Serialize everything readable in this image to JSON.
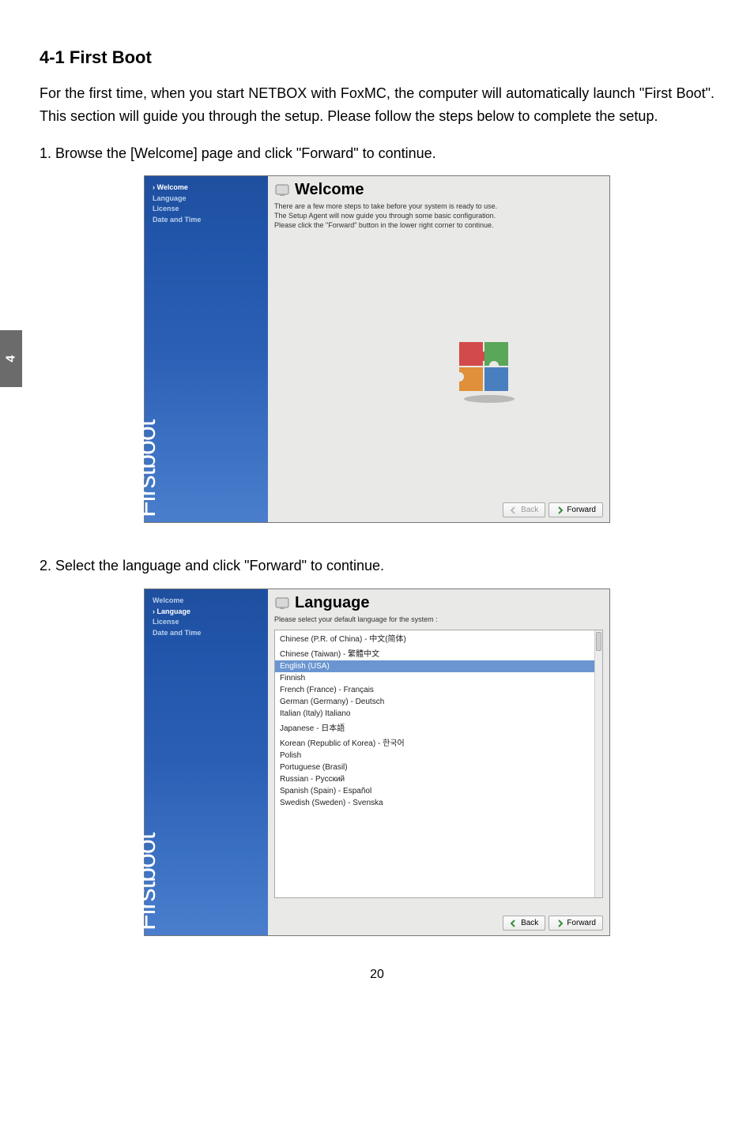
{
  "sideTab": "4",
  "sectionTitle": "4-1 First Boot",
  "intro": "For the first time, when you start NETBOX with FoxMC, the computer will automatically launch \"First Boot\". This section will guide you through the setup. Please follow the steps below to complete the setup.",
  "step1": "1. Browse the [Welcome] page and click \"Forward\" to continue.",
  "step2": "2. Select the language and click \"Forward\" to continue.",
  "pageNumber": "20",
  "screenshot1": {
    "sidebarLabel": "Firstboot",
    "nav": {
      "welcome": "Welcome",
      "language": "Language",
      "license": "License",
      "datetime": "Date and Time"
    },
    "title": "Welcome",
    "descLine1": "There are a few more steps to take before your system is ready to use.",
    "descLine2": "The Setup Agent will now guide you through some basic configuration.",
    "descLine3": "Please click the \"Forward\" button in the lower right corner to continue.",
    "backBtn": "Back",
    "forwardBtn": "Forward"
  },
  "screenshot2": {
    "sidebarLabel": "Firstboot",
    "nav": {
      "welcome": "Welcome",
      "language": "Language",
      "license": "License",
      "datetime": "Date and Time"
    },
    "title": "Language",
    "desc": "Please select your default language for the system :",
    "langs": {
      "l0": "Chinese (P.R. of China) - 中文(简体)",
      "l1": "Chinese (Taiwan) - 繁體中文",
      "l2": "English (USA)",
      "l3": "Finnish",
      "l4": "French (France) - Français",
      "l5": "German (Germany) - Deutsch",
      "l6": "Italian (Italy) Italiano",
      "l7": "Japanese - 日本語",
      "l8": "Korean (Republic of Korea) - 한국어",
      "l9": "Polish",
      "l10": "Portuguese (Brasil)",
      "l11": "Russian - Русский",
      "l12": "Spanish (Spain) - Español",
      "l13": "Swedish (Sweden) - Svenska"
    },
    "backBtn": "Back",
    "forwardBtn": "Forward"
  }
}
